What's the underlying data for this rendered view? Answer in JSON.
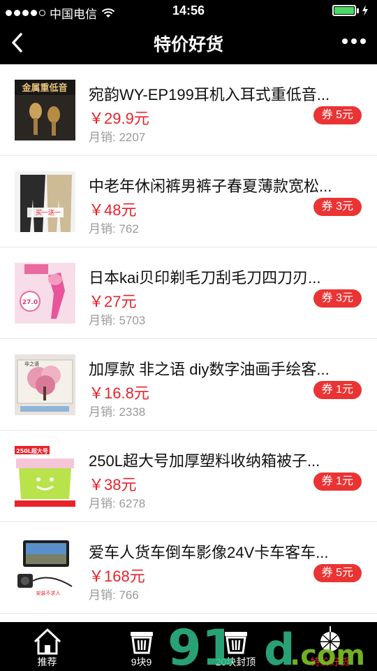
{
  "status": {
    "carrier": "中国电信",
    "time": "14:56"
  },
  "nav": {
    "title": "特价好货"
  },
  "products": [
    {
      "title": "宛韵WY-EP199耳机入耳式重低音...",
      "price": "￥29.9元",
      "sales": "月销: 2207",
      "coupon": "券 5元",
      "thumb_text": "金属重低音"
    },
    {
      "title": "中老年休闲裤男裤子春夏薄款宽松...",
      "price": "￥48元",
      "sales": "月销: 762",
      "coupon": "券 3元",
      "thumb_text": "买一送一"
    },
    {
      "title": "日本kai贝印剃毛刀刮毛刀四刀刃...",
      "price": "￥27元",
      "sales": "月销: 5703",
      "coupon": "券 3元",
      "thumb_text": "27.0"
    },
    {
      "title": "加厚款 非之语 diy数字油画手绘客...",
      "price": "￥16.8元",
      "sales": "月销: 2338",
      "coupon": "券 1元",
      "thumb_text": "非之语"
    },
    {
      "title": "250L超大号加厚塑料收纳箱被子...",
      "price": "￥38元",
      "sales": "月销: 6278",
      "coupon": "券 1元",
      "thumb_text": "250L超大号"
    },
    {
      "title": "爱车人货车倒车影像24V卡车客车...",
      "price": "￥168元",
      "sales": "月销: 766",
      "coupon": "券 5元",
      "thumb_text": "安装不求人"
    }
  ],
  "tabs": [
    {
      "label": "推荐",
      "icon": "home-icon"
    },
    {
      "label": "9块9",
      "icon": "basket-icon"
    },
    {
      "label": "20块封顶",
      "icon": "basket-icon"
    },
    {
      "label": "特价好货",
      "icon": "disco-ball-icon"
    }
  ],
  "watermark": "91rd.com",
  "colors": {
    "accent": "#e8222a",
    "coupon": "#ea3434",
    "bar": "#000000",
    "battery": "#4cd964"
  }
}
